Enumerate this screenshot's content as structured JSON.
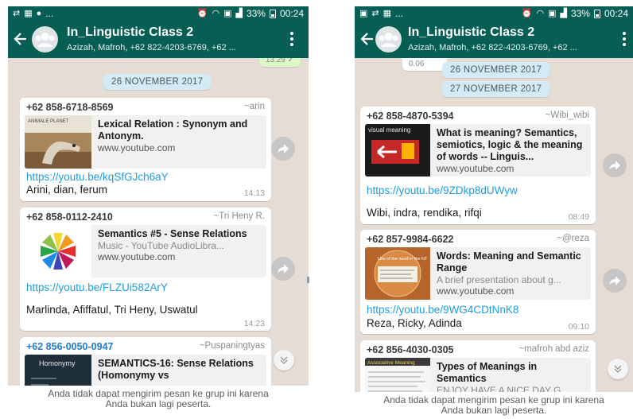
{
  "left": {
    "status": {
      "battery": "33%",
      "time": "00:24",
      "dots": "..."
    },
    "header": {
      "title": "In_Linguistic Class 2",
      "members": "Azizah, Mafroh, +62 822-4203-6769, +62 ..."
    },
    "chat": {
      "prev_time": "13.29 ✓",
      "date_pills": [
        "26 NOVEMBER 2017"
      ],
      "messages": [
        {
          "sender": "+62 858-6718-8569",
          "alias": "~arin",
          "preview_title": "Lexical Relation : Synonym and Antonym.",
          "preview_desc": "",
          "preview_domain": "www.youtube.com",
          "thumb_label": "ANIMALE PLANET",
          "link": "https://youtu.be/kqSfGJch6aY",
          "caption": "Arini, dian, ferum",
          "time": "14:13"
        },
        {
          "sender": "+62 858-0112-2410",
          "alias": "~Tri Heny R.",
          "preview_title": "Semantics #5 - Sense Relations",
          "preview_desc": "Music - YouTube AudioLibra...",
          "preview_domain": "www.youtube.com",
          "thumb_label": "",
          "link": "https://youtu.be/FLZUi582ArY",
          "caption": "Marlinda, Afiffatul, Tri Heny, Uswatul",
          "time": "14:23"
        },
        {
          "sender": "+62 856-0050-0947",
          "alias": "~Puspaningtyas",
          "preview_title": "SEMANTICS-16: Sense Relations (Homonymy vs",
          "preview_desc": "",
          "preview_domain": "",
          "thumb_label": "Homonymy",
          "link": "",
          "caption": "",
          "time": ""
        }
      ]
    },
    "footer": {
      "line1": "Anda tidak dapat mengirim pesan ke grup ini karena",
      "line2": "Anda bukan lagi peserta."
    }
  },
  "right": {
    "status": {
      "battery": "33%",
      "time": "00:24",
      "dots": "..."
    },
    "header": {
      "title": "In_Linguistic Class 2",
      "members": "Azizah, Mafroh, +62 822-4203-6769, +62 ..."
    },
    "chat": {
      "prev_time": "0.06",
      "date_pills": [
        "26 NOVEMBER 2017",
        "27 NOVEMBER 2017"
      ],
      "messages": [
        {
          "sender": "+62 858-4870-5394",
          "alias": "~Wibi_wibi",
          "preview_title": "What is meaning? Semantics, semiotics, logic & the meaning of words -- Linguis...",
          "preview_desc": "",
          "preview_domain": "www.youtube.com",
          "thumb_label": "visual meaning",
          "link": "https://youtu.be/9ZDkp8dUWyw",
          "caption": "Wibi, indra, rendika, rifqi",
          "time": "08:49"
        },
        {
          "sender": "+62 857-9984-6622",
          "alias": "~@reza",
          "preview_title": "Words: Meaning and Semantic Range",
          "preview_desc": "A brief presentation about g...",
          "preview_domain": "www.youtube.com",
          "thumb_label": "Use of the word in the NT",
          "link": "https://youtu.be/9WG4CDtNnK8",
          "caption": "Reza, Ricky, Adinda",
          "time": "09:10"
        },
        {
          "sender": "+62 856-4030-0305",
          "alias": "~mafroh abd aziz",
          "preview_title": "Types of Meanings in Semantics",
          "preview_desc": "ENJOY HAVE A NICE DAY G...",
          "preview_domain": "",
          "thumb_label": "Associative Meaning",
          "link": "",
          "caption": "",
          "time": ""
        }
      ]
    },
    "footer": {
      "line1": "Anda tidak dapat mengirim pesan ke grup ini karena",
      "line2": "Anda bukan lagi peserta."
    }
  },
  "colors": {
    "header": "#075e54",
    "chat_bg": "#e5ddd5",
    "link": "#1f9be0",
    "date_pill": "#d4eaf4",
    "sent_bubble": "#dcf8c6"
  }
}
